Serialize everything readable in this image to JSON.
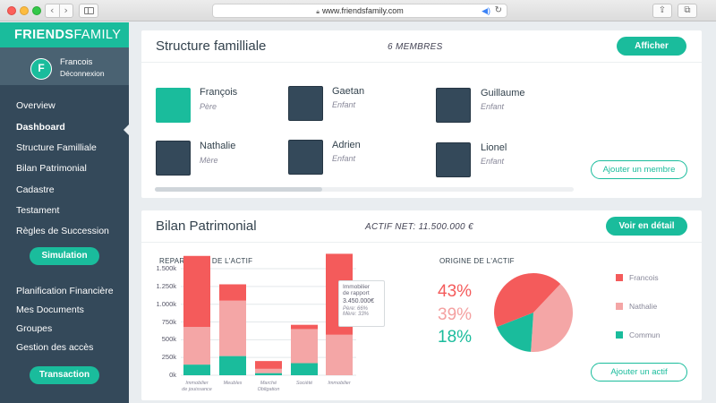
{
  "browser": {
    "url": "www.friendsfamily.com",
    "back": "‹",
    "forward": "›",
    "reload": "↻",
    "share": "⇪",
    "tabs": "⧉"
  },
  "sidebar": {
    "brand_bold": "FRIENDS",
    "brand_thin": "FAMILY",
    "user_initial": "F",
    "user_name": "Francois",
    "logout": "Déconnexion",
    "nav": [
      "Overview",
      "Dashboard",
      "Structure Familliale",
      "Bilan Patrimonial",
      "Cadastre",
      "Testament",
      "Règles de Succession"
    ],
    "simulation": "Simulation",
    "nav2": [
      "Planification Financière",
      "Mes Documents",
      "Groupes",
      "Gestion des accès"
    ],
    "transaction": "Transaction",
    "active_item": "Dashboard"
  },
  "structure": {
    "title": "Structure familliale",
    "count": "6 MEMBRES",
    "button": "Afficher",
    "add_button": "Ajouter un membre",
    "members": [
      {
        "name": "François",
        "role": "Père",
        "color": "#1abc9c"
      },
      {
        "name": "Gaetan",
        "role": "Enfant",
        "color": "#34495a"
      },
      {
        "name": "Guillaume",
        "role": "Enfant",
        "color": "#34495a"
      },
      {
        "name": "Nathalie",
        "role": "Mère",
        "color": "#34495a"
      },
      {
        "name": "Adrien",
        "role": "Enfant",
        "color": "#34495a"
      },
      {
        "name": "Lionel",
        "role": "Enfant",
        "color": "#34495a"
      }
    ]
  },
  "bilan": {
    "title": "Bilan Patrimonial",
    "actif_net": "ACTIF NET: 11.500.000 €",
    "button": "Voir en détail",
    "add_button": "Ajouter un actif",
    "repartition_title": "REPARTITION DE L'ACTIF",
    "origine_title": "ORIGINE DE L'ACTIF",
    "tooltip": {
      "line1": "Immobilier",
      "line2": "de rapport",
      "value": "3.450.000€",
      "pere": "Père: 66%",
      "mere": "Mère: 33%"
    },
    "percentages": [
      {
        "label": "43%",
        "color": "#f45b5b"
      },
      {
        "label": "39%",
        "color": "#f4a0a0"
      },
      {
        "label": "18%",
        "color": "#1abc9c"
      }
    ],
    "legend": [
      {
        "label": "Francois",
        "color": "#f45b5b"
      },
      {
        "label": "Nathalie",
        "color": "#f4a6a6"
      },
      {
        "label": "Commun",
        "color": "#1abc9c"
      }
    ]
  },
  "chart_data": [
    {
      "type": "bar",
      "title": "REPARTITION DE L'ACTIF",
      "categories": [
        "Immobilier de jouissance",
        "Meubles",
        "Marché Obligation",
        "Société",
        "Immobilier"
      ],
      "x_tick_labels": [
        [
          "Immobilier",
          "de jouissance"
        ],
        [
          "Meubles"
        ],
        [
          "Marché",
          "Obligation"
        ],
        [
          "Société"
        ],
        [
          "Immobilier"
        ]
      ],
      "ylim": [
        0,
        1700000
      ],
      "y_ticks": [
        0,
        250000,
        500000,
        750000,
        1000000,
        1250000,
        1500000
      ],
      "y_tick_labels": [
        "0k",
        "250k",
        "500k",
        "750k",
        "1.000k",
        "1.250k",
        "1.500k"
      ],
      "stacked": true,
      "series": [
        {
          "color": "#1abc9c",
          "values": [
            150000,
            270000,
            30000,
            170000,
            0
          ]
        },
        {
          "color": "#f4a6a6",
          "values": [
            530000,
            780000,
            60000,
            480000,
            570000
          ]
        },
        {
          "color": "#f45b5b",
          "values": [
            1000000,
            230000,
            110000,
            60000,
            1140000
          ]
        }
      ],
      "grid": true
    },
    {
      "type": "pie",
      "title": "ORIGINE DE L'ACTIF",
      "labels": [
        "Francois",
        "Nathalie",
        "Commun"
      ],
      "values": [
        43,
        39,
        18
      ],
      "colors": [
        "#f45b5b",
        "#f4a6a6",
        "#1abc9c"
      ]
    }
  ]
}
